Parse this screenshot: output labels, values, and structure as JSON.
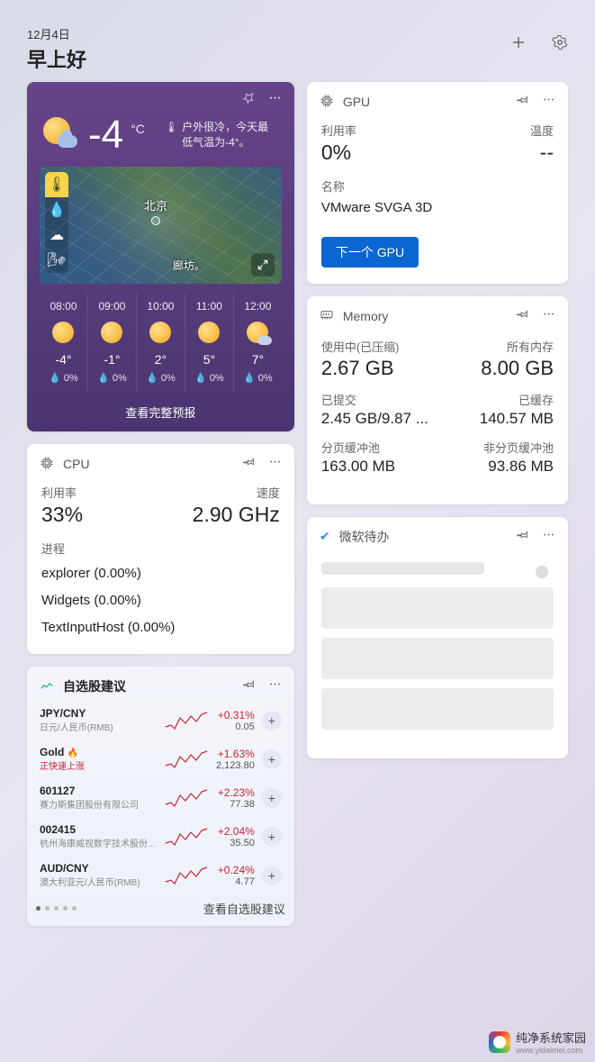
{
  "header": {
    "date": "12月4日",
    "greeting": "早上好"
  },
  "weather": {
    "temp": "-4",
    "unit": "°C",
    "desc1": "户外很冷，今天最",
    "desc2": "低气温为-4°。",
    "city": "北京",
    "city2": "廊坊。",
    "full_forecast": "查看完整预报",
    "forecast": [
      {
        "time": "08:00",
        "temp": "-4°",
        "rain": "0%",
        "icon": "sun"
      },
      {
        "time": "09:00",
        "temp": "-1°",
        "rain": "0%",
        "icon": "sun"
      },
      {
        "time": "10:00",
        "temp": "2°",
        "rain": "0%",
        "icon": "sun"
      },
      {
        "time": "11:00",
        "temp": "5°",
        "rain": "0%",
        "icon": "sun"
      },
      {
        "time": "12:00",
        "temp": "7°",
        "rain": "0%",
        "icon": "cloudy"
      }
    ]
  },
  "gpu": {
    "title": "GPU",
    "util_label": "利用率",
    "temp_label": "温度",
    "util_val": "0%",
    "temp_val": "--",
    "name_label": "名称",
    "name_val": "VMware SVGA 3D",
    "next_btn": "下一个 GPU"
  },
  "cpu": {
    "title": "CPU",
    "util_label": "利用率",
    "speed_label": "速度",
    "util_val": "33%",
    "speed_val": "2.90 GHz",
    "proc_label": "进程",
    "procs": [
      "explorer (0.00%)",
      "Widgets (0.00%)",
      "TextInputHost (0.00%)"
    ]
  },
  "memory": {
    "title": "Memory",
    "used_label": "使用中(已压缩)",
    "total_label": "所有内存",
    "used_val": "2.67 GB",
    "total_val": "8.00 GB",
    "commit_label": "已提交",
    "cached_label": "已缓存",
    "commit_val": "2.45 GB/9.87 ...",
    "cached_val": "140.57 MB",
    "paged_label": "分页缓冲池",
    "nonpaged_label": "非分页缓冲池",
    "paged_val": "163.00 MB",
    "nonpaged_val": "93.86 MB"
  },
  "todo": {
    "title": "微软待办"
  },
  "stocks": {
    "title": "自选股建议",
    "footer_link": "查看自选股建议",
    "rows": [
      {
        "sym": "JPY/CNY",
        "sub": "日元/人民币(RMB)",
        "pct": "+0.31%",
        "price": "0.05",
        "red": false,
        "fire": false
      },
      {
        "sym": "Gold",
        "sub": "正快速上涨",
        "pct": "+1.63%",
        "price": "2,123.80",
        "red": true,
        "fire": true
      },
      {
        "sym": "601127",
        "sub": "赛力斯集团股份有限公司",
        "pct": "+2.23%",
        "price": "77.38",
        "red": false,
        "fire": false
      },
      {
        "sym": "002415",
        "sub": "杭州海康威视数字技术股份...",
        "pct": "+2.04%",
        "price": "35.50",
        "red": false,
        "fire": false
      },
      {
        "sym": "AUD/CNY",
        "sub": "澳大利亚元/人民币(RMB)",
        "pct": "+0.24%",
        "price": "4.77",
        "red": false,
        "fire": false
      }
    ]
  },
  "watermark": {
    "title": "纯净系统家园",
    "url": "www.yidaimei.com"
  }
}
